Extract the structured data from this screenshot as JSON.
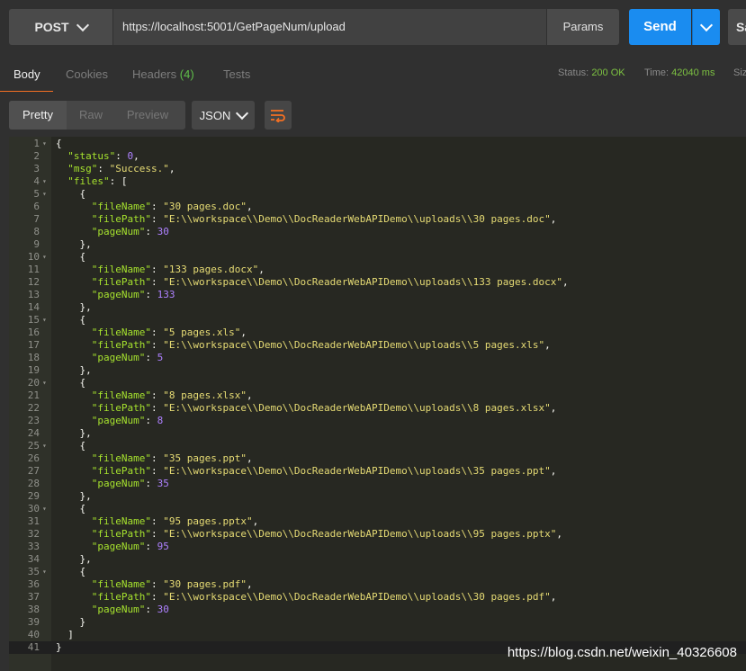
{
  "request": {
    "method": "POST",
    "url": "https://localhost:5001/GetPageNum/upload",
    "params_label": "Params",
    "send_label": "Send",
    "save_label": "Sa"
  },
  "response_tabs": {
    "body": "Body",
    "cookies": "Cookies",
    "headers": "Headers",
    "headers_count": "(4)",
    "tests": "Tests"
  },
  "status": {
    "status_label": "Status:",
    "status_value": "200 OK",
    "time_label": "Time:",
    "time_value": "42040 ms",
    "size_label": "Siz"
  },
  "format": {
    "pretty": "Pretty",
    "raw": "Raw",
    "preview": "Preview",
    "type": "JSON"
  },
  "body": {
    "status": 0,
    "msg": "Success.",
    "files": [
      {
        "fileName": "30 pages.doc",
        "filePath": "E:\\\\workspace\\\\Demo\\\\DocReaderWebAPIDemo\\\\uploads\\\\30 pages.doc",
        "pageNum": 30
      },
      {
        "fileName": "133 pages.docx",
        "filePath": "E:\\\\workspace\\\\Demo\\\\DocReaderWebAPIDemo\\\\uploads\\\\133 pages.docx",
        "pageNum": 133
      },
      {
        "fileName": "5 pages.xls",
        "filePath": "E:\\\\workspace\\\\Demo\\\\DocReaderWebAPIDemo\\\\uploads\\\\5 pages.xls",
        "pageNum": 5
      },
      {
        "fileName": "8 pages.xlsx",
        "filePath": "E:\\\\workspace\\\\Demo\\\\DocReaderWebAPIDemo\\\\uploads\\\\8 pages.xlsx",
        "pageNum": 8
      },
      {
        "fileName": "35 pages.ppt",
        "filePath": "E:\\\\workspace\\\\Demo\\\\DocReaderWebAPIDemo\\\\uploads\\\\35 pages.ppt",
        "pageNum": 35
      },
      {
        "fileName": "95 pages.pptx",
        "filePath": "E:\\\\workspace\\\\Demo\\\\DocReaderWebAPIDemo\\\\uploads\\\\95 pages.pptx",
        "pageNum": 95
      },
      {
        "fileName": "30 pages.pdf",
        "filePath": "E:\\\\workspace\\\\Demo\\\\DocReaderWebAPIDemo\\\\uploads\\\\30 pages.pdf",
        "pageNum": 30
      }
    ]
  },
  "watermark": "https://blog.csdn.net/weixin_40326608",
  "colors": {
    "accent": "#f47023",
    "send": "#1a8cf0",
    "status_ok": "#7dc242",
    "json_key": "#a6e22e",
    "json_string": "#e6db74",
    "json_number": "#ae81ff"
  },
  "icons": {
    "method_dropdown": "chevron-down-icon",
    "send_dropdown": "chevron-down-icon",
    "format_dropdown": "chevron-down-icon",
    "wrap": "wrap-lines-icon",
    "fold": "fold-arrow-icon"
  }
}
